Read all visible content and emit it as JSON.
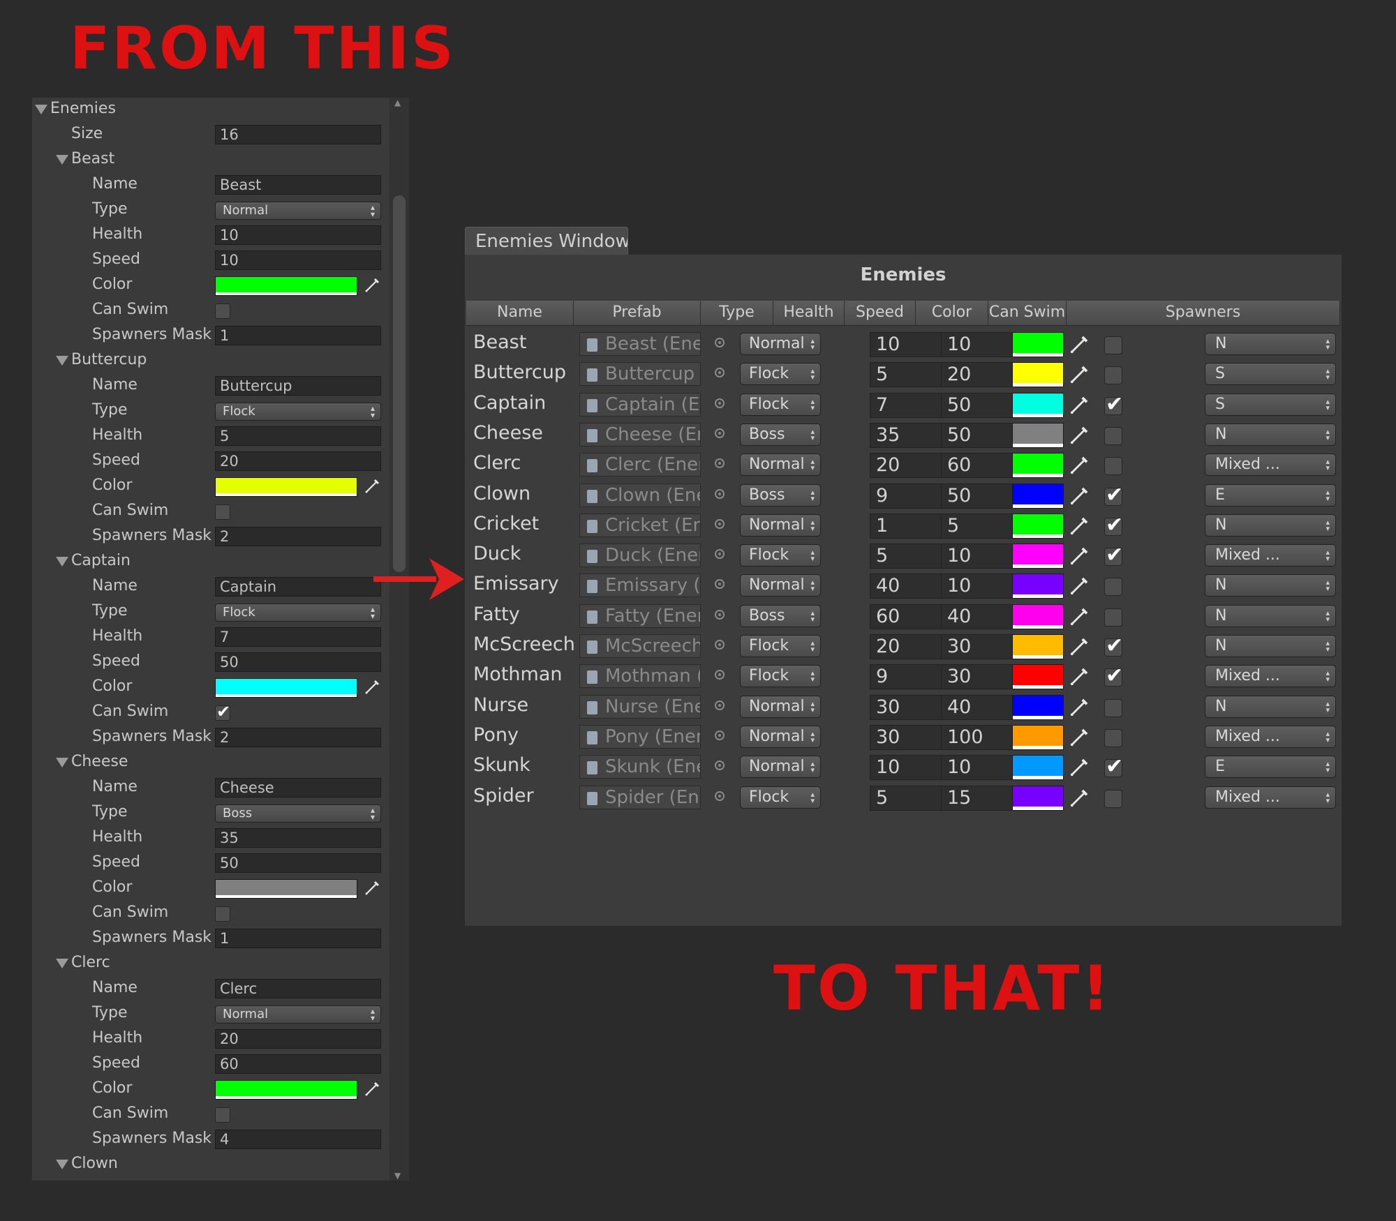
{
  "captions": {
    "from": "FROM THIS",
    "to": "TO THAT!"
  },
  "inspector": {
    "root_label": "Enemies",
    "size_label": "Size",
    "size_value": "16",
    "field_labels": {
      "name": "Name",
      "type": "Type",
      "health": "Health",
      "speed": "Speed",
      "color": "Color",
      "can_swim": "Can Swim",
      "spawners_mask": "Spawners Mask"
    },
    "enemies": [
      {
        "header": "Beast",
        "name": "Beast",
        "type": "Normal",
        "health": "10",
        "speed": "10",
        "color": "#00ff00",
        "can_swim": false,
        "spawners_mask": "1"
      },
      {
        "header": "Buttercup",
        "name": "Buttercup",
        "type": "Flock",
        "health": "5",
        "speed": "20",
        "color": "#e5ff00",
        "can_swim": false,
        "spawners_mask": "2"
      },
      {
        "header": "Captain",
        "name": "Captain",
        "type": "Flock",
        "health": "7",
        "speed": "50",
        "color": "#00ffff",
        "can_swim": true,
        "spawners_mask": "2"
      },
      {
        "header": "Cheese",
        "name": "Cheese",
        "type": "Boss",
        "health": "35",
        "speed": "50",
        "color": "#808080",
        "can_swim": false,
        "spawners_mask": "1"
      },
      {
        "header": "Clerc",
        "name": "Clerc",
        "type": "Normal",
        "health": "20",
        "speed": "60",
        "color": "#00ff00",
        "can_swim": false,
        "spawners_mask": "4"
      }
    ],
    "last_header": "Clown"
  },
  "window": {
    "tab_label": "Enemies Window",
    "title": "Enemies",
    "columns": [
      "Name",
      "Prefab",
      "Type",
      "Health",
      "Speed",
      "Color",
      "Can Swim",
      "Spawners"
    ],
    "rows": [
      {
        "name": "Beast",
        "prefab": "Beast (Enemy)",
        "type": "Normal",
        "health": "10",
        "speed": "10",
        "color": "#00ff00",
        "can_swim": false,
        "spawners": "N"
      },
      {
        "name": "Buttercup",
        "prefab": "Buttercup (Enemy)",
        "type": "Flock",
        "health": "5",
        "speed": "20",
        "color": "#ffff00",
        "can_swim": false,
        "spawners": "S"
      },
      {
        "name": "Captain",
        "prefab": "Captain (Enemy)",
        "type": "Flock",
        "health": "7",
        "speed": "50",
        "color": "#00ffe0",
        "can_swim": true,
        "spawners": "S"
      },
      {
        "name": "Cheese",
        "prefab": "Cheese (Enemy)",
        "type": "Boss",
        "health": "35",
        "speed": "50",
        "color": "#808080",
        "can_swim": false,
        "spawners": "N"
      },
      {
        "name": "Clerc",
        "prefab": "Clerc (Enemy)",
        "type": "Normal",
        "health": "20",
        "speed": "60",
        "color": "#00ff00",
        "can_swim": false,
        "spawners": "Mixed ..."
      },
      {
        "name": "Clown",
        "prefab": "Clown (Enemy)",
        "type": "Boss",
        "health": "9",
        "speed": "50",
        "color": "#0000ff",
        "can_swim": true,
        "spawners": "E"
      },
      {
        "name": "Cricket",
        "prefab": "Cricket (Enemy)",
        "type": "Normal",
        "health": "1",
        "speed": "5",
        "color": "#00ff00",
        "can_swim": true,
        "spawners": "N"
      },
      {
        "name": "Duck",
        "prefab": "Duck (Enemy)",
        "type": "Flock",
        "health": "5",
        "speed": "10",
        "color": "#ff00ff",
        "can_swim": true,
        "spawners": "Mixed ..."
      },
      {
        "name": "Emissary",
        "prefab": "Emissary (Enemy)",
        "type": "Normal",
        "health": "40",
        "speed": "10",
        "color": "#7700ff",
        "can_swim": false,
        "spawners": "N"
      },
      {
        "name": "Fatty",
        "prefab": "Fatty (Enemy)",
        "type": "Boss",
        "health": "60",
        "speed": "40",
        "color": "#ff00ee",
        "can_swim": false,
        "spawners": "N"
      },
      {
        "name": "McScreech",
        "prefab": "McScreech (Enemy)",
        "type": "Flock",
        "health": "20",
        "speed": "30",
        "color": "#ffbb00",
        "can_swim": true,
        "spawners": "N"
      },
      {
        "name": "Mothman",
        "prefab": "Mothman (Enemy)",
        "type": "Flock",
        "health": "9",
        "speed": "30",
        "color": "#ff0000",
        "can_swim": true,
        "spawners": "Mixed ..."
      },
      {
        "name": "Nurse",
        "prefab": "Nurse (Enemy)",
        "type": "Normal",
        "health": "30",
        "speed": "40",
        "color": "#0000ff",
        "can_swim": false,
        "spawners": "N"
      },
      {
        "name": "Pony",
        "prefab": "Pony (Enemy)",
        "type": "Normal",
        "health": "30",
        "speed": "100",
        "color": "#ff9900",
        "can_swim": false,
        "spawners": "Mixed ..."
      },
      {
        "name": "Skunk",
        "prefab": "Skunk (Enemy)",
        "type": "Normal",
        "health": "10",
        "speed": "10",
        "color": "#0099ff",
        "can_swim": true,
        "spawners": "E"
      },
      {
        "name": "Spider",
        "prefab": "Spider (Enemy)",
        "type": "Flock",
        "health": "5",
        "speed": "15",
        "color": "#7700ff",
        "can_swim": false,
        "spawners": "Mixed ..."
      }
    ]
  }
}
